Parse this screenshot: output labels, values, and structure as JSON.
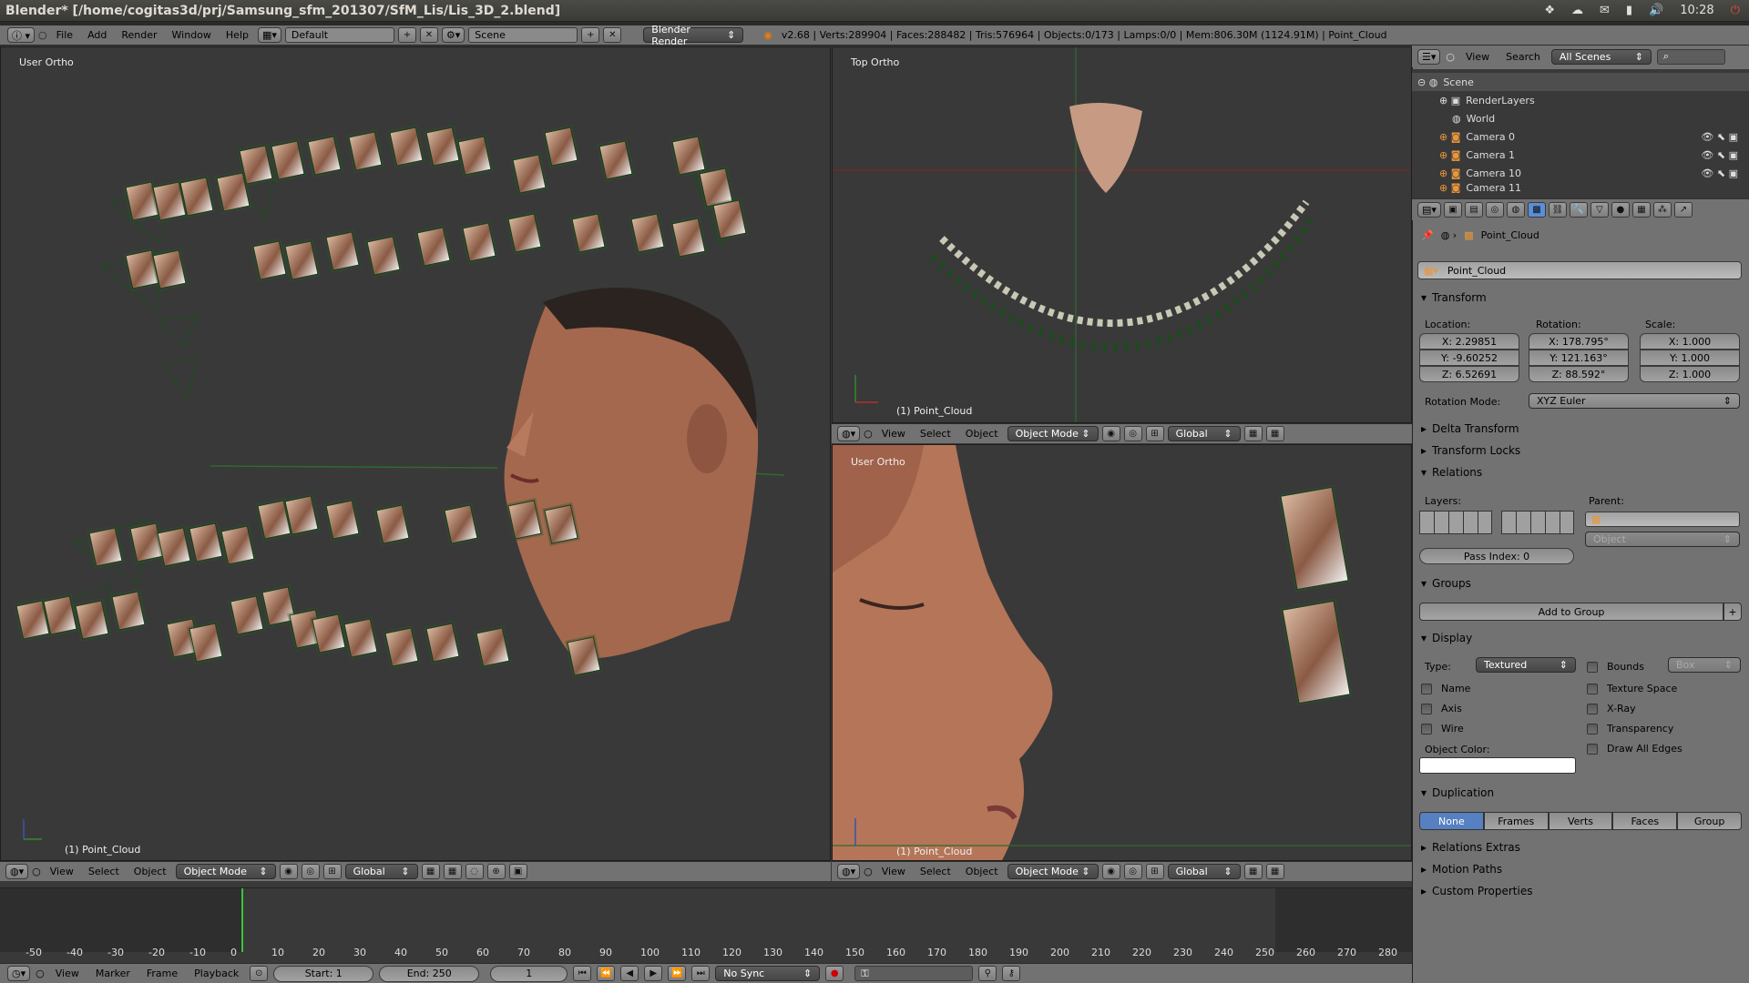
{
  "title": "Blender* [/home/cogitas3d/prj/Samsung_sfm_201307/SfM_Lis/Lis_3D_2.blend]",
  "tray": {
    "time": "10:28"
  },
  "info": {
    "menus": [
      "File",
      "Add",
      "Render",
      "Window",
      "Help"
    ],
    "layout": "Default",
    "scene": "Scene",
    "engine": "Blender Render",
    "stats": "v2.68 | Verts:289904 | Faces:288482 | Tris:576964 | Objects:0/173 | Lamps:0/0 | Mem:806.30M (1124.91M) | Point_Cloud"
  },
  "viewports": {
    "left": {
      "name": "User Ortho",
      "object": "(1) Point_Cloud"
    },
    "topright": {
      "name": "Top Ortho",
      "object": "(1) Point_Cloud"
    },
    "bottomright": {
      "name": "User Ortho",
      "object": "(1) Point_Cloud"
    }
  },
  "vpheader": {
    "view": "View",
    "select": "Select",
    "object": "Object",
    "mode": "Object Mode",
    "orient": "Global"
  },
  "outliner": {
    "view": "View",
    "search": "Search",
    "filter": "All Scenes",
    "rows": [
      "Scene",
      "RenderLayers",
      "World",
      "Camera 0",
      "Camera 1",
      "Camera 10",
      "Camera 11"
    ]
  },
  "props": {
    "object_name": "Point_Cloud",
    "transform": {
      "title": "Transform",
      "loc_label": "Location:",
      "rot_label": "Rotation:",
      "scale_label": "Scale:",
      "loc": [
        "X: 2.29851",
        "Y: -9.60252",
        "Z: 6.52691"
      ],
      "rot": [
        "X: 178.795°",
        "Y: 121.163°",
        "Z: 88.592°"
      ],
      "scale": [
        "X: 1.000",
        "Y: 1.000",
        "Z: 1.000"
      ],
      "rotmode_label": "Rotation Mode:",
      "rotmode": "XYZ Euler"
    },
    "delta": "Delta Transform",
    "locks": "Transform Locks",
    "relations": "Relations",
    "layers": "Layers:",
    "parent": "Parent:",
    "parent_type": "Object",
    "pass_index": "Pass Index: 0",
    "groups": "Groups",
    "add_group": "Add to Group",
    "display": {
      "title": "Display",
      "type_label": "Type:",
      "type": "Textured",
      "bounds": "Bounds",
      "box": "Box",
      "name": "Name",
      "texspace": "Texture Space",
      "axis": "Axis",
      "xray": "X-Ray",
      "wire": "Wire",
      "transparency": "Transparency",
      "objcolor": "Object Color:",
      "drawedges": "Draw All Edges"
    },
    "duplication": {
      "title": "Duplication",
      "opts": [
        "None",
        "Frames",
        "Verts",
        "Faces",
        "Group"
      ]
    },
    "extras": "Relations Extras",
    "motion": "Motion Paths",
    "custom": "Custom Properties"
  },
  "timeline": {
    "ticks": [
      "-50",
      "-40",
      "-30",
      "-20",
      "-10",
      "0",
      "10",
      "20",
      "30",
      "40",
      "50",
      "60",
      "70",
      "80",
      "90",
      "100",
      "110",
      "120",
      "130",
      "140",
      "150",
      "160",
      "170",
      "180",
      "190",
      "200",
      "210",
      "220",
      "230",
      "240",
      "250",
      "260",
      "270",
      "280"
    ],
    "menus": [
      "View",
      "Marker",
      "Frame",
      "Playback"
    ],
    "start": "Start: 1",
    "end": "End: 250",
    "current": "1",
    "sync": "No Sync"
  }
}
